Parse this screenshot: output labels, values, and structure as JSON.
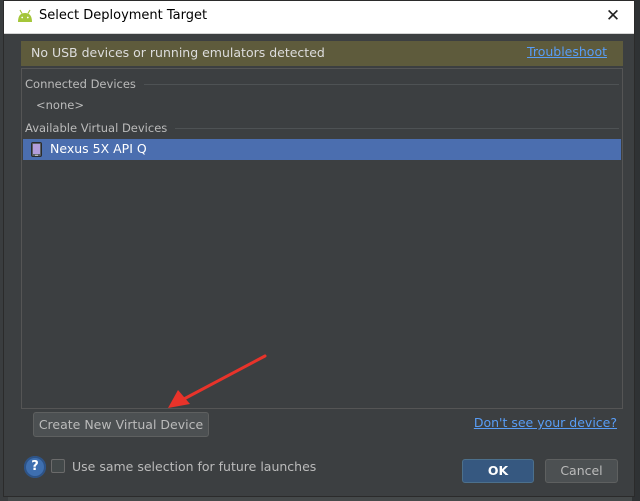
{
  "dialog": {
    "title": "Select Deployment Target",
    "close_icon": "close-icon",
    "title_icon": "android-icon"
  },
  "banner": {
    "message": "No USB devices or running emulators detected",
    "link": "Troubleshoot",
    "color": "#5e5b3c"
  },
  "connected_devices": {
    "header": "Connected Devices",
    "items": [
      "<none>"
    ]
  },
  "available_virtual_devices": {
    "header": "Available Virtual Devices",
    "items": [
      {
        "name": "Nexus 5X API Q",
        "icon": "phone-icon",
        "selected": true
      }
    ]
  },
  "actions": {
    "create_button": "Create New Virtual Device",
    "dont_see_link": "Don't see your device?",
    "help_icon": "help-icon",
    "help_label": "?",
    "remember_checkbox": "Use same selection for future launches",
    "remember_checked": false,
    "ok_button": "OK",
    "cancel_button": "Cancel"
  },
  "colors": {
    "selection": "#4b6eaf",
    "link": "#589df6",
    "dialog_bg": "#3c3f41",
    "primary_button": "#365880",
    "annotation_arrow": "#e8332a"
  },
  "annotation": {
    "icon": "red-arrow-icon",
    "points_to": "Create New Virtual Device"
  }
}
